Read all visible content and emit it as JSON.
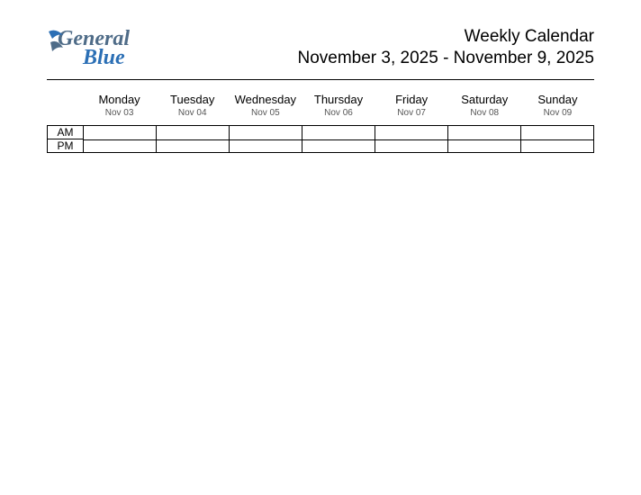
{
  "logo": {
    "line1": "General",
    "line2": "Blue"
  },
  "header": {
    "title": "Weekly Calendar",
    "range": "November 3, 2025 - November 9, 2025"
  },
  "days": [
    {
      "name": "Monday",
      "date": "Nov 03"
    },
    {
      "name": "Tuesday",
      "date": "Nov 04"
    },
    {
      "name": "Wednesday",
      "date": "Nov 05"
    },
    {
      "name": "Thursday",
      "date": "Nov 06"
    },
    {
      "name": "Friday",
      "date": "Nov 07"
    },
    {
      "name": "Saturday",
      "date": "Nov 08"
    },
    {
      "name": "Sunday",
      "date": "Nov 09"
    }
  ],
  "periods": [
    "AM",
    "PM"
  ]
}
